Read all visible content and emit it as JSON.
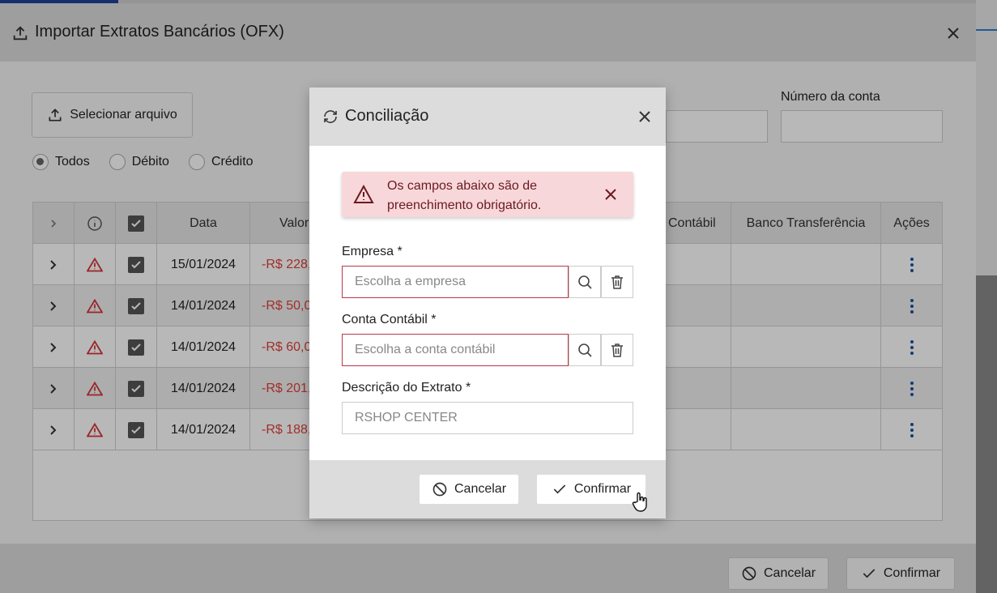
{
  "main_dialog": {
    "title": "Importar Extratos Bancários (OFX)",
    "select_file_label": "Selecionar arquivo",
    "account_number_label": "Número da conta",
    "filters": [
      {
        "label": "Todos",
        "selected": true
      },
      {
        "label": "Débito",
        "selected": false
      },
      {
        "label": "Crédito",
        "selected": false
      }
    ],
    "cancel_label": "Cancelar",
    "confirm_label": "Confirmar"
  },
  "table": {
    "headers": {
      "date": "Data",
      "value": "Valor",
      "account": "Contábil",
      "bank_transfer": "Banco Transferência",
      "actions": "Ações"
    },
    "rows": [
      {
        "date": "15/01/2024",
        "value": "-R$ 228,"
      },
      {
        "date": "14/01/2024",
        "value": "-R$ 50,0"
      },
      {
        "date": "14/01/2024",
        "value": "-R$ 60,0"
      },
      {
        "date": "14/01/2024",
        "value": "-R$ 201,"
      },
      {
        "date": "14/01/2024",
        "value": "-R$ 188,"
      }
    ]
  },
  "reconciliation_dialog": {
    "title": "Conciliação",
    "alert_text": "Os campos abaixo são de preenchimento obrigatório.",
    "company_label": "Empresa *",
    "company_placeholder": "Escolha a empresa",
    "account_label": "Conta Contábil *",
    "account_placeholder": "Escolha a conta contábil",
    "description_label": "Descrição do Extrato *",
    "description_value": "RSHOP CENTER",
    "cancel_label": "Cancelar",
    "confirm_label": "Confirmar"
  },
  "colors": {
    "negative_value": "#e0403a",
    "alert_bg": "#f8d7da",
    "invalid_border": "#b8394a",
    "kebab": "#1e4fa8"
  }
}
